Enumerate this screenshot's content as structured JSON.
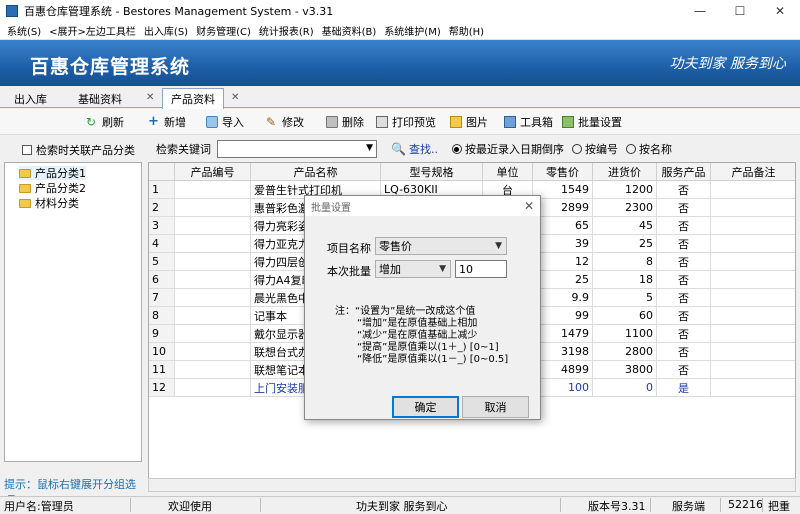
{
  "window": {
    "title": "百惠仓库管理系统 - Bestores Management System - v3.31",
    "minimize": "—",
    "maximize": "☐",
    "close": "✕"
  },
  "menu": [
    "系统(S)",
    "<展开>左边工具栏",
    "出入库(S)",
    "财务管理(C)",
    "统计报表(R)",
    "基础资料(B)",
    "系统维护(M)",
    "帮助(H)"
  ],
  "banner": {
    "title": "百惠仓库管理系统",
    "slogan": "功夫到家 服务到心"
  },
  "tabs": [
    {
      "label": "出入库"
    },
    {
      "label": "基础资料"
    },
    {
      "label": "产品资料"
    }
  ],
  "toolbar": {
    "refresh": "刷新",
    "add": "新增",
    "import": "导入",
    "edit": "修改",
    "delete": "删除",
    "print": "打印预览",
    "image": "图片",
    "tools": "工具箱",
    "batch": "批量设置"
  },
  "left": {
    "checkbox_label": "检索时关联产品分类",
    "tree": [
      "产品分类1",
      "产品分类2",
      "材料分类"
    ],
    "hint": "提示：鼠标右键展开分组选项"
  },
  "search": {
    "label": "检索关键词",
    "value": "",
    "button": "查找..",
    "radio": [
      "按最近录入日期倒序",
      "按编号",
      "按名称"
    ]
  },
  "grid": {
    "columns": [
      "",
      "产品编号",
      "产品名称",
      "型号规格",
      "单位",
      "零售价",
      "进货价",
      "服务产品",
      "产品备注"
    ],
    "rows": [
      {
        "n": "1",
        "name": "爱普生针式打印机",
        "model": "LQ-630KII",
        "unit": "台",
        "retail": "1549",
        "cost": "1200",
        "svc": "否"
      },
      {
        "n": "2",
        "name": "惠普彩色激",
        "model": "",
        "unit": "",
        "retail": "2899",
        "cost": "2300",
        "svc": "否"
      },
      {
        "n": "3",
        "name": "得力亮彩姿",
        "model": "",
        "unit": "",
        "retail": "65",
        "cost": "45",
        "svc": "否"
      },
      {
        "n": "4",
        "name": "得力亚克力",
        "model": "",
        "unit": "",
        "retail": "39",
        "cost": "25",
        "svc": "否"
      },
      {
        "n": "5",
        "name": "得力四层创",
        "model": "",
        "unit": "",
        "retail": "12",
        "cost": "8",
        "svc": "否"
      },
      {
        "n": "6",
        "name": "得力A4复印",
        "model": "",
        "unit": "",
        "retail": "25",
        "cost": "18",
        "svc": "否"
      },
      {
        "n": "7",
        "name": "晨光黑色中",
        "model": "",
        "unit": "",
        "retail": "9.9",
        "cost": "5",
        "svc": "否"
      },
      {
        "n": "8",
        "name": "记事本",
        "model": "",
        "unit": "",
        "retail": "99",
        "cost": "60",
        "svc": "否"
      },
      {
        "n": "9",
        "name": "戴尔显示器",
        "model": "",
        "unit": "",
        "retail": "1479",
        "cost": "1100",
        "svc": "否"
      },
      {
        "n": "10",
        "name": "联想台式办",
        "model": "",
        "unit": "",
        "retail": "3198",
        "cost": "2800",
        "svc": "否"
      },
      {
        "n": "11",
        "name": "联想笔记本",
        "model": "",
        "unit": "",
        "retail": "4899",
        "cost": "3800",
        "svc": "否"
      },
      {
        "n": "12",
        "name": "上门安装服",
        "model": "",
        "unit": "",
        "retail": "100",
        "cost": "0",
        "svc": "是"
      }
    ]
  },
  "dialog": {
    "title": "批量设置",
    "field_label": "项目名称",
    "field_value": "零售价",
    "batch_label": "本次批量",
    "op_value": "增加",
    "amount": "10",
    "notes": [
      "注：“设置为”是统一改成这个值",
      "“增加”是在原值基础上相加",
      "“减少”是在原值基础上减少",
      "“提高”是原值乘以(1＋_) [0~1]",
      "“降低”是原值乘以(1－_) [0~0.5]"
    ],
    "ok": "确定",
    "cancel": "取消"
  },
  "status": {
    "user": "用户名:管理员",
    "welcome": "欢迎使用",
    "slogan": "功夫到家 服务到心",
    "version": "版本号3.31",
    "service": "服务端",
    "port": "52216",
    "right": "把重"
  },
  "colors": {
    "banner": "#1d5fa8",
    "accent": "#0078d7",
    "hint": "#1a6fb5",
    "service_row": "#1a3aa8"
  }
}
